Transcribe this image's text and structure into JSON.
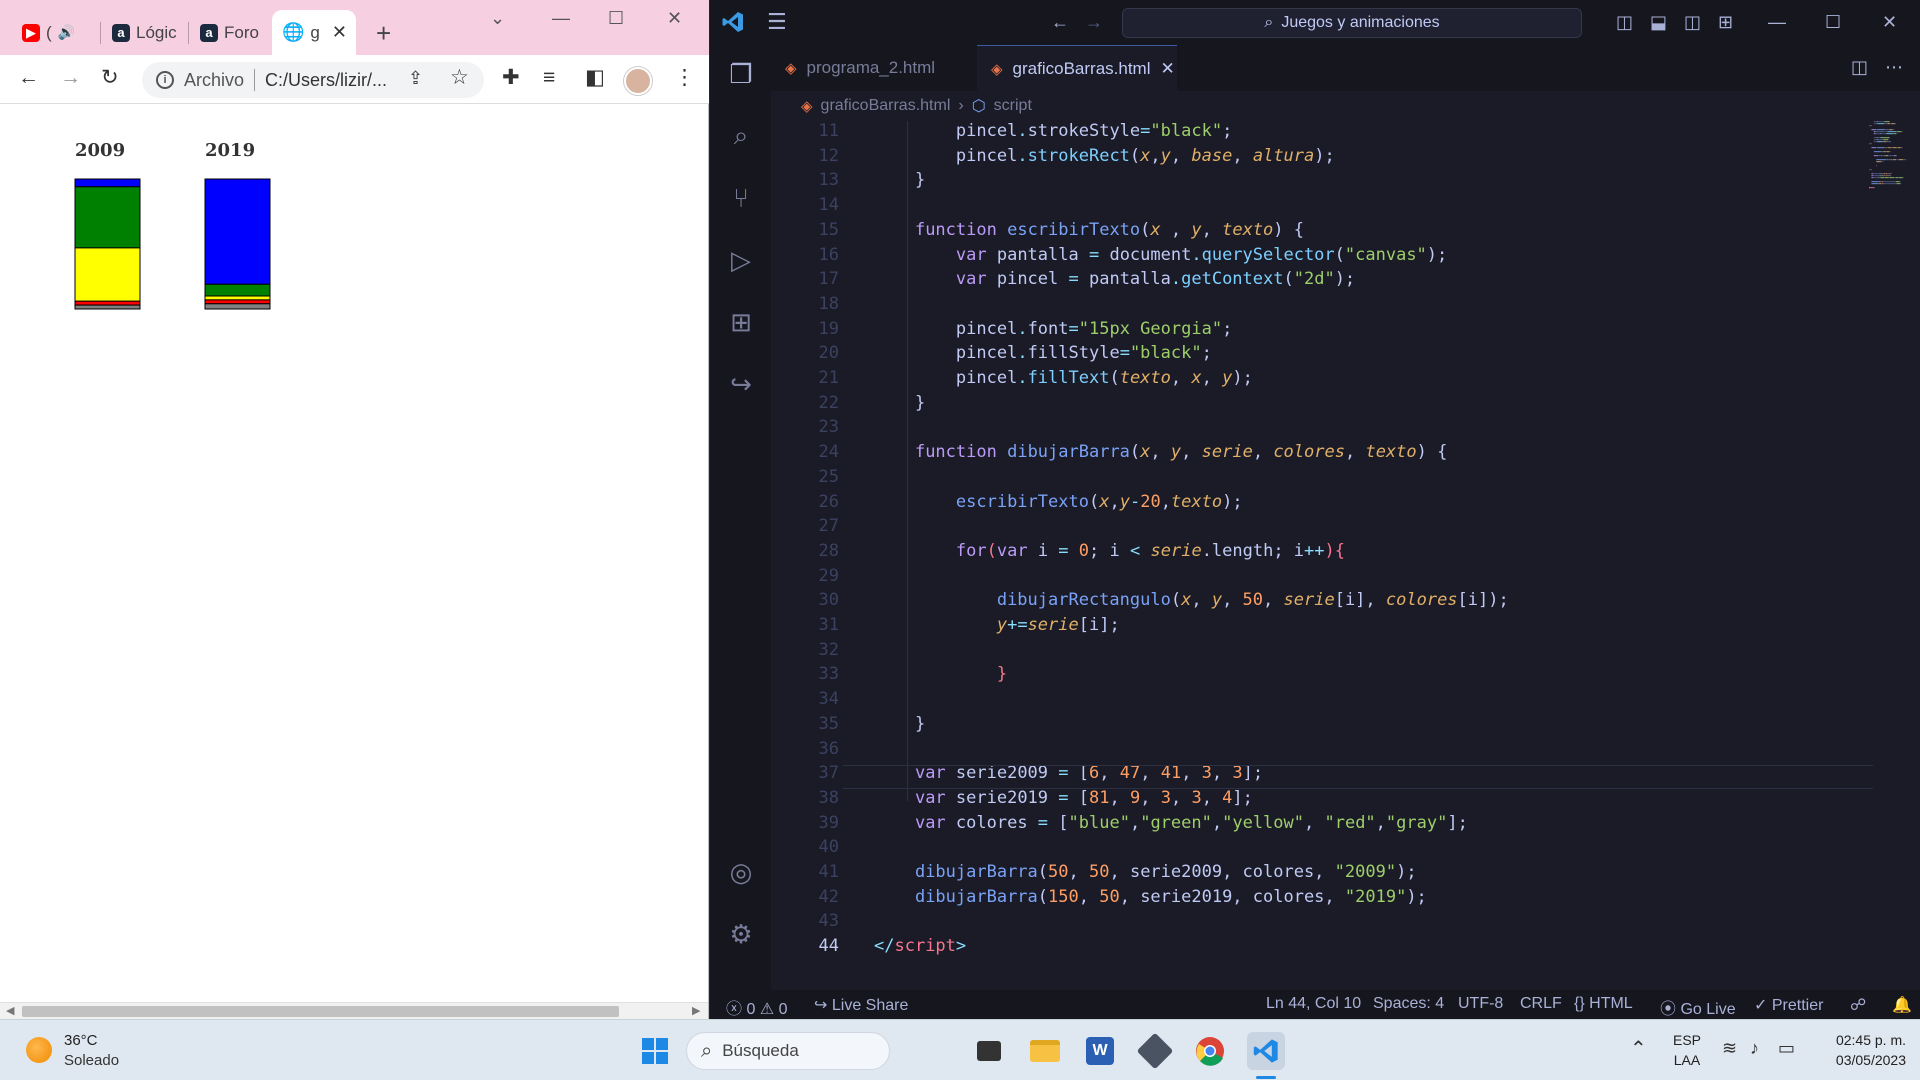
{
  "browser": {
    "tabs": [
      {
        "label": "(",
        "icon": "youtube-icon"
      },
      {
        "label": "Lógic",
        "icon": "alura-icon"
      },
      {
        "label": "Foro",
        "icon": "alura-icon"
      },
      {
        "label": "g",
        "icon": "globe-icon"
      }
    ],
    "address": {
      "security_label": "Archivo",
      "url": "C:/Users/lizir/..."
    }
  },
  "chart_data": {
    "type": "bar",
    "categories": [
      "2009",
      "2019"
    ],
    "stacked": true,
    "series": [
      {
        "color": "#0000ff",
        "values": [
          6,
          81
        ]
      },
      {
        "color": "#008000",
        "values": [
          47,
          9
        ]
      },
      {
        "color": "#ffff00",
        "values": [
          41,
          3
        ]
      },
      {
        "color": "#ff0000",
        "values": [
          3,
          3
        ]
      },
      {
        "color": "#808080",
        "values": [
          3,
          4
        ]
      }
    ]
  },
  "vscode": {
    "command_center": "Juegos y animaciones",
    "tabs": [
      {
        "label": "programa_2.html",
        "active": false
      },
      {
        "label": "graficoBarras.html",
        "active": true
      }
    ],
    "breadcrumb": [
      "graficoBarras.html",
      "script"
    ],
    "code_lines": [
      {
        "n": "11",
        "t": [
          [
            "        ",
            "txt"
          ],
          [
            "pincel",
            "txt"
          ],
          [
            ".",
            "punc"
          ],
          [
            "strokeStyle",
            "txt"
          ],
          [
            "=",
            "punc"
          ],
          [
            "\"black\"",
            "str"
          ],
          [
            ";",
            "txt"
          ]
        ]
      },
      {
        "n": "12",
        "t": [
          [
            "        ",
            "txt"
          ],
          [
            "pincel",
            "txt"
          ],
          [
            ".",
            "punc"
          ],
          [
            "strokeRect",
            "mfn"
          ],
          [
            "(",
            "txt"
          ],
          [
            "x",
            "par"
          ],
          [
            ",",
            "txt"
          ],
          [
            "y",
            "par"
          ],
          [
            ", ",
            "txt"
          ],
          [
            "base",
            "par"
          ],
          [
            ", ",
            "txt"
          ],
          [
            "altura",
            "par"
          ],
          [
            ");",
            "txt"
          ]
        ]
      },
      {
        "n": "13",
        "t": [
          [
            "    }",
            "txt"
          ]
        ]
      },
      {
        "n": "14",
        "t": []
      },
      {
        "n": "15",
        "t": [
          [
            "    ",
            "txt"
          ],
          [
            "function",
            "kw"
          ],
          [
            " ",
            "txt"
          ],
          [
            "escribirTexto",
            "fn"
          ],
          [
            "(",
            "txt"
          ],
          [
            "x",
            "par"
          ],
          [
            " , ",
            "txt"
          ],
          [
            "y",
            "par"
          ],
          [
            ", ",
            "txt"
          ],
          [
            "texto",
            "par"
          ],
          [
            ") {",
            "txt"
          ]
        ]
      },
      {
        "n": "16",
        "t": [
          [
            "        ",
            "txt"
          ],
          [
            "var",
            "kw"
          ],
          [
            " pantalla ",
            "txt"
          ],
          [
            "=",
            "punc"
          ],
          [
            " document",
            "txt"
          ],
          [
            ".",
            "punc"
          ],
          [
            "querySelector",
            "mfn"
          ],
          [
            "(",
            "txt"
          ],
          [
            "\"canvas\"",
            "str"
          ],
          [
            ");",
            "txt"
          ]
        ]
      },
      {
        "n": "17",
        "t": [
          [
            "        ",
            "txt"
          ],
          [
            "var",
            "kw"
          ],
          [
            " pincel ",
            "txt"
          ],
          [
            "=",
            "punc"
          ],
          [
            " pantalla",
            "txt"
          ],
          [
            ".",
            "punc"
          ],
          [
            "getContext",
            "mfn"
          ],
          [
            "(",
            "txt"
          ],
          [
            "\"2d\"",
            "str"
          ],
          [
            ");",
            "txt"
          ]
        ]
      },
      {
        "n": "18",
        "t": []
      },
      {
        "n": "19",
        "t": [
          [
            "        ",
            "txt"
          ],
          [
            "pincel",
            "txt"
          ],
          [
            ".",
            "punc"
          ],
          [
            "font",
            "txt"
          ],
          [
            "=",
            "punc"
          ],
          [
            "\"15px Georgia\"",
            "str"
          ],
          [
            ";",
            "txt"
          ]
        ]
      },
      {
        "n": "20",
        "t": [
          [
            "        ",
            "txt"
          ],
          [
            "pincel",
            "txt"
          ],
          [
            ".",
            "punc"
          ],
          [
            "fillStyle",
            "txt"
          ],
          [
            "=",
            "punc"
          ],
          [
            "\"black\"",
            "str"
          ],
          [
            ";",
            "txt"
          ]
        ]
      },
      {
        "n": "21",
        "t": [
          [
            "        ",
            "txt"
          ],
          [
            "pincel",
            "txt"
          ],
          [
            ".",
            "punc"
          ],
          [
            "fillText",
            "mfn"
          ],
          [
            "(",
            "txt"
          ],
          [
            "texto",
            "par"
          ],
          [
            ", ",
            "txt"
          ],
          [
            "x",
            "par"
          ],
          [
            ", ",
            "txt"
          ],
          [
            "y",
            "par"
          ],
          [
            ");",
            "txt"
          ]
        ]
      },
      {
        "n": "22",
        "t": [
          [
            "    }",
            "txt"
          ]
        ]
      },
      {
        "n": "23",
        "t": []
      },
      {
        "n": "24",
        "t": [
          [
            "    ",
            "txt"
          ],
          [
            "function",
            "kw"
          ],
          [
            " ",
            "txt"
          ],
          [
            "dibujarBarra",
            "fn"
          ],
          [
            "(",
            "txt"
          ],
          [
            "x",
            "par"
          ],
          [
            ", ",
            "txt"
          ],
          [
            "y",
            "par"
          ],
          [
            ", ",
            "txt"
          ],
          [
            "serie",
            "par"
          ],
          [
            ", ",
            "txt"
          ],
          [
            "colores",
            "par"
          ],
          [
            ", ",
            "txt"
          ],
          [
            "texto",
            "par"
          ],
          [
            ") {",
            "txt"
          ]
        ]
      },
      {
        "n": "25",
        "t": []
      },
      {
        "n": "26",
        "t": [
          [
            "        ",
            "txt"
          ],
          [
            "escribirTexto",
            "fn"
          ],
          [
            "(",
            "txt"
          ],
          [
            "x",
            "par"
          ],
          [
            ",",
            "txt"
          ],
          [
            "y",
            "par"
          ],
          [
            "-",
            "punc"
          ],
          [
            "20",
            "num"
          ],
          [
            ",",
            "txt"
          ],
          [
            "texto",
            "par"
          ],
          [
            ");",
            "txt"
          ]
        ]
      },
      {
        "n": "27",
        "t": []
      },
      {
        "n": "28",
        "t": [
          [
            "        ",
            "txt"
          ],
          [
            "for",
            "kw"
          ],
          [
            "(",
            "brk"
          ],
          [
            "var",
            "kw"
          ],
          [
            " i ",
            "txt"
          ],
          [
            "=",
            "punc"
          ],
          [
            " ",
            "txt"
          ],
          [
            "0",
            "num"
          ],
          [
            "; i ",
            "txt"
          ],
          [
            "<",
            "punc"
          ],
          [
            " ",
            "txt"
          ],
          [
            "serie",
            "par"
          ],
          [
            ".length; i",
            "txt"
          ],
          [
            "++",
            "punc"
          ],
          [
            "){",
            "brk"
          ]
        ]
      },
      {
        "n": "29",
        "t": []
      },
      {
        "n": "30",
        "t": [
          [
            "            ",
            "txt"
          ],
          [
            "dibujarRectangulo",
            "fn"
          ],
          [
            "(",
            "txt"
          ],
          [
            "x",
            "par"
          ],
          [
            ", ",
            "txt"
          ],
          [
            "y",
            "par"
          ],
          [
            ", ",
            "txt"
          ],
          [
            "50",
            "num"
          ],
          [
            ", ",
            "txt"
          ],
          [
            "serie",
            "par"
          ],
          [
            "[i], ",
            "txt"
          ],
          [
            "colores",
            "par"
          ],
          [
            "[i]);",
            "txt"
          ]
        ]
      },
      {
        "n": "31",
        "t": [
          [
            "            ",
            "txt"
          ],
          [
            "y",
            "par"
          ],
          [
            "+=",
            "punc"
          ],
          [
            "serie",
            "par"
          ],
          [
            "[i];",
            "txt"
          ]
        ]
      },
      {
        "n": "32",
        "t": []
      },
      {
        "n": "33",
        "t": [
          [
            "            ",
            "txt"
          ],
          [
            "}",
            "brk"
          ]
        ]
      },
      {
        "n": "34",
        "t": []
      },
      {
        "n": "35",
        "t": [
          [
            "    }",
            "txt"
          ]
        ]
      },
      {
        "n": "36",
        "t": []
      },
      {
        "n": "37",
        "t": [
          [
            "    ",
            "txt"
          ],
          [
            "var",
            "kw"
          ],
          [
            " serie2009 ",
            "txt"
          ],
          [
            "=",
            "punc"
          ],
          [
            " [",
            "txt"
          ],
          [
            "6",
            "num"
          ],
          [
            ", ",
            "txt"
          ],
          [
            "47",
            "num"
          ],
          [
            ", ",
            "txt"
          ],
          [
            "41",
            "num"
          ],
          [
            ", ",
            "txt"
          ],
          [
            "3",
            "num"
          ],
          [
            ", ",
            "txt"
          ],
          [
            "3",
            "num"
          ],
          [
            "];",
            "txt"
          ]
        ]
      },
      {
        "n": "38",
        "t": [
          [
            "    ",
            "txt"
          ],
          [
            "var",
            "kw"
          ],
          [
            " serie2019 ",
            "txt"
          ],
          [
            "=",
            "punc"
          ],
          [
            " [",
            "txt"
          ],
          [
            "81",
            "num"
          ],
          [
            ", ",
            "txt"
          ],
          [
            "9",
            "num"
          ],
          [
            ", ",
            "txt"
          ],
          [
            "3",
            "num"
          ],
          [
            ", ",
            "txt"
          ],
          [
            "3",
            "num"
          ],
          [
            ", ",
            "txt"
          ],
          [
            "4",
            "num"
          ],
          [
            "];",
            "txt"
          ]
        ]
      },
      {
        "n": "39",
        "t": [
          [
            "    ",
            "txt"
          ],
          [
            "var",
            "kw"
          ],
          [
            " colores ",
            "txt"
          ],
          [
            "=",
            "punc"
          ],
          [
            " [",
            "txt"
          ],
          [
            "\"blue\"",
            "str"
          ],
          [
            ",",
            "txt"
          ],
          [
            "\"green\"",
            "str"
          ],
          [
            ",",
            "txt"
          ],
          [
            "\"yellow\"",
            "str"
          ],
          [
            ", ",
            "txt"
          ],
          [
            "\"red\"",
            "str"
          ],
          [
            ",",
            "txt"
          ],
          [
            "\"gray\"",
            "str"
          ],
          [
            "];",
            "txt"
          ]
        ]
      },
      {
        "n": "40",
        "t": []
      },
      {
        "n": "41",
        "t": [
          [
            "    ",
            "txt"
          ],
          [
            "dibujarBarra",
            "fn"
          ],
          [
            "(",
            "txt"
          ],
          [
            "50",
            "num"
          ],
          [
            ", ",
            "txt"
          ],
          [
            "50",
            "num"
          ],
          [
            ", serie2009, colores, ",
            "txt"
          ],
          [
            "\"2009\"",
            "str"
          ],
          [
            ");",
            "txt"
          ]
        ]
      },
      {
        "n": "42",
        "t": [
          [
            "    ",
            "txt"
          ],
          [
            "dibujarBarra",
            "fn"
          ],
          [
            "(",
            "txt"
          ],
          [
            "150",
            "num"
          ],
          [
            ", ",
            "txt"
          ],
          [
            "50",
            "num"
          ],
          [
            ", serie2019, colores, ",
            "txt"
          ],
          [
            "\"2019\"",
            "str"
          ],
          [
            ");",
            "txt"
          ]
        ]
      },
      {
        "n": "43",
        "t": []
      },
      {
        "n": "44",
        "t": [
          [
            "</",
            "punc"
          ],
          [
            "script",
            "tag"
          ],
          [
            ">",
            "punc"
          ]
        ]
      }
    ],
    "status": {
      "errors": "0",
      "warnings": "0",
      "live_share": "Live Share",
      "position": "Ln 44, Col 10",
      "spaces": "Spaces: 4",
      "encoding": "UTF-8",
      "eol": "CRLF",
      "language": "HTML",
      "go_live": "Go Live",
      "prettier": "Prettier"
    }
  },
  "taskbar": {
    "weather_temp": "36°C",
    "weather_desc": "Soleado",
    "search_placeholder": "Búsqueda",
    "lang_1": "ESP",
    "lang_2": "LAA",
    "time": "02:45 p. m.",
    "date": "03/05/2023"
  }
}
